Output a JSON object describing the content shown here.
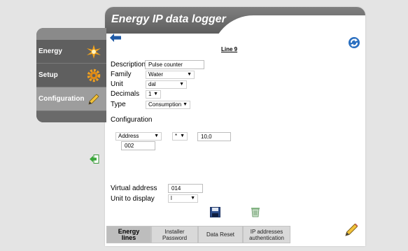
{
  "panel": {
    "title": "Energy IP data logger"
  },
  "sidebar": {
    "items": [
      {
        "label": "Energy",
        "icon": "energy-icon"
      },
      {
        "label": "Setup",
        "icon": "gear-icon"
      },
      {
        "label": "Configuration",
        "icon": "pencil-icon"
      }
    ]
  },
  "form": {
    "heading": "Line 9",
    "description": {
      "label": "Description",
      "value": "Pulse counter"
    },
    "family": {
      "label": "Family",
      "value": "Water"
    },
    "unit": {
      "label": "Unit",
      "value": "dal"
    },
    "decimals": {
      "label": "Decimals",
      "value": "1"
    },
    "type": {
      "label": "Type",
      "value": "Consumption"
    },
    "configuration": {
      "label": "Configuration",
      "field": "Address",
      "operator": "*",
      "factor": "10,0",
      "address_value": "002"
    },
    "virtual_address": {
      "label": "Virtual address",
      "value": "014"
    },
    "unit_to_display": {
      "label": "Unit to display",
      "value": "l"
    }
  },
  "tabs": [
    {
      "line1": "Energy",
      "line2": "lines"
    },
    {
      "line1": "Installer",
      "line2": "Password"
    },
    {
      "line1": "Data Reset",
      "line2": ""
    },
    {
      "line1": "IP addresses",
      "line2": "authentication"
    }
  ],
  "colors": {
    "accent_blue": "#1f5aa6",
    "header_gray": "#6e6e6e",
    "active_tab": "#bdbdbd"
  }
}
